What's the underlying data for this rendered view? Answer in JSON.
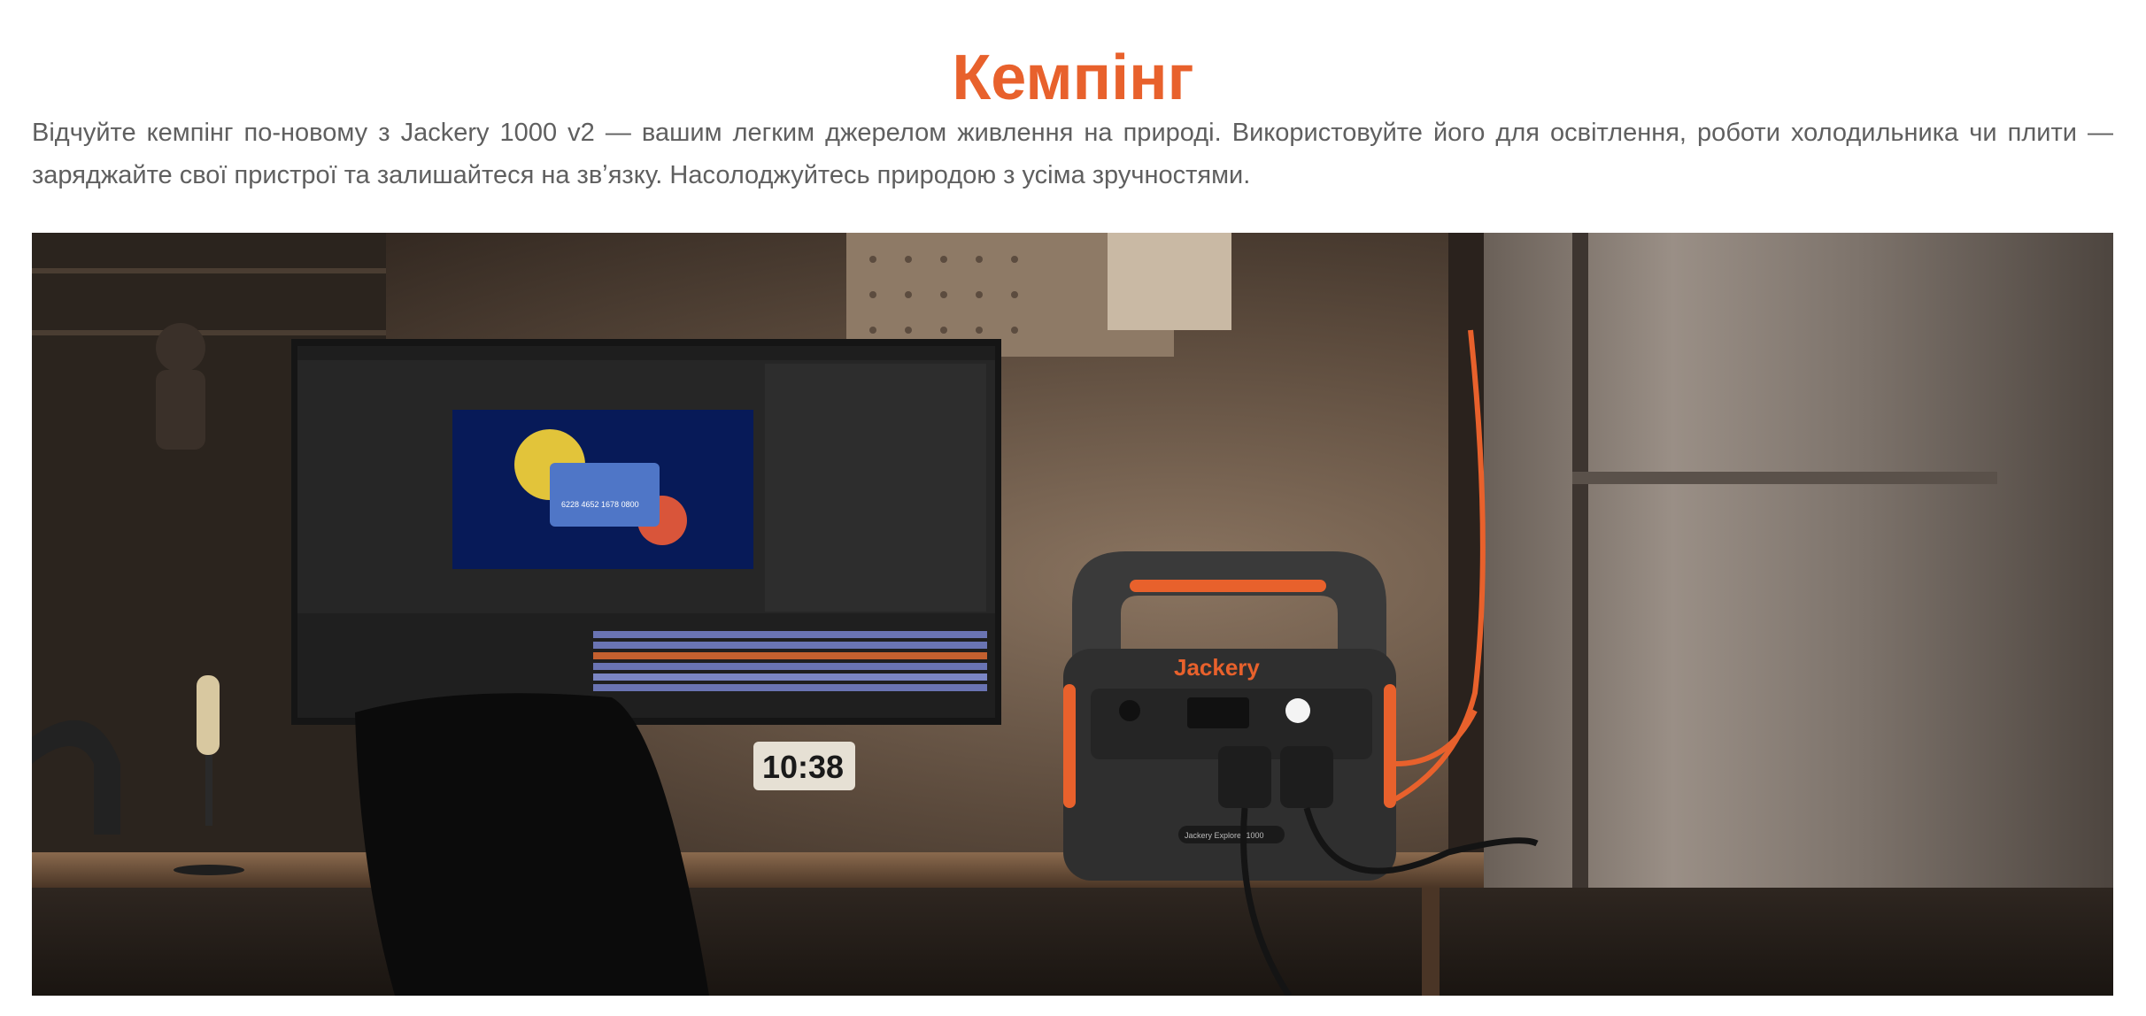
{
  "section": {
    "title": "Кемпінг",
    "description": "Відчуйте кемпінг по-новому з Jackery 1000 v2 — вашим легким джерелом живлення на природі. Використовуйте його для освітлення, роботи холодильника чи плити — заряджайте свої пристрої та залишайтеся на звʼязку. Насолоджуйтесь природою з усіма зручностями."
  },
  "photo": {
    "brand_logo": "Jackery",
    "clock_time": "10:38",
    "card_number": "6228 4652 1678 0800",
    "device_label": "Jackery Explorer 1000"
  },
  "colors": {
    "accent": "#e8612c",
    "text": "#5f5f5f",
    "background": "#ffffff"
  }
}
